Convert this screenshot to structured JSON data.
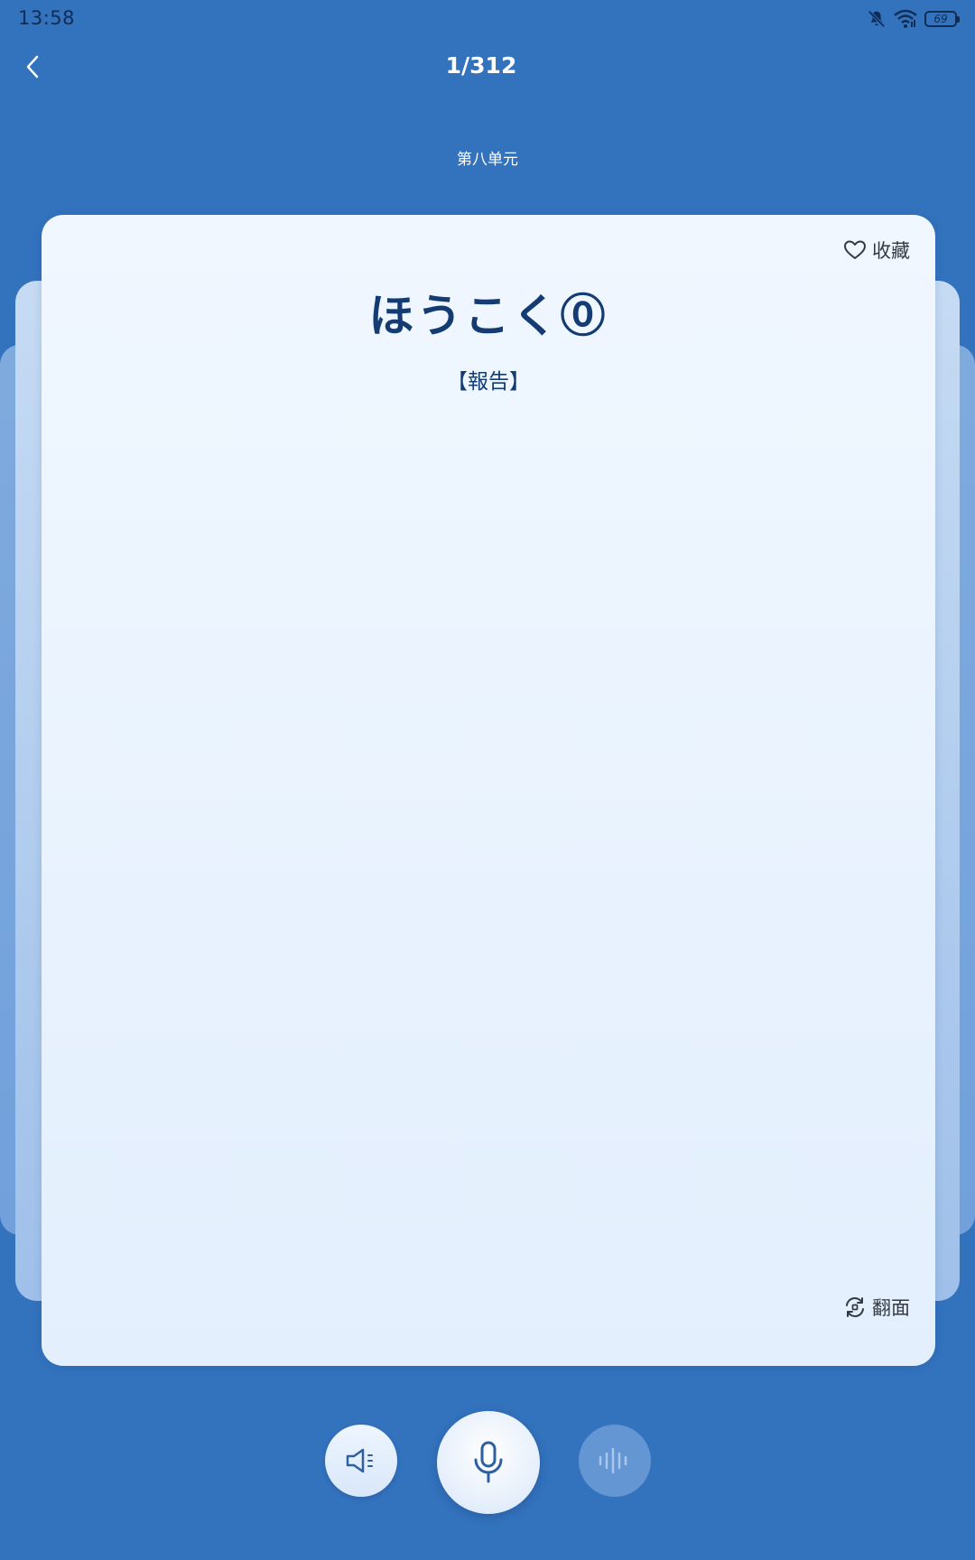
{
  "status_bar": {
    "time": "13:58",
    "battery_level": "69",
    "icons": [
      "bell-muted-icon",
      "wifi-icon",
      "battery-icon"
    ]
  },
  "header": {
    "progress": "1/312",
    "unit": "第八单元"
  },
  "card": {
    "reading": "ほうこく⓪",
    "kanji": "【報告】",
    "favorite_label": "收藏",
    "flip_label": "翻面"
  },
  "controls": {
    "icons": [
      "speaker-icon",
      "microphone-icon",
      "waveform-icon"
    ]
  },
  "colors": {
    "background": "#3372bd",
    "card": "#f0f7ff",
    "text_primary": "#143c72"
  }
}
